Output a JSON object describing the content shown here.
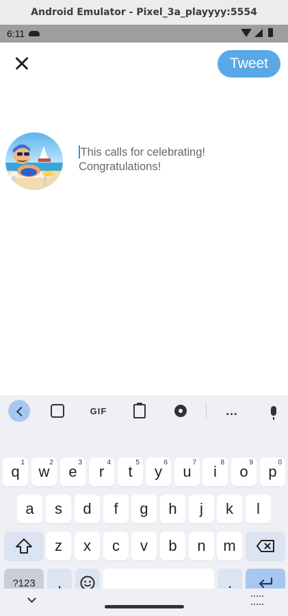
{
  "window": {
    "title": "Android Emulator - Pixel_3a_playyyy:5554"
  },
  "status_bar": {
    "time": "6:11"
  },
  "compose": {
    "tweet_label": "Tweet",
    "text_line1": "This calls for celebrating!",
    "text_line2": "Congratulations!"
  },
  "keyboard": {
    "toolbar": {
      "gif_label": "GIF",
      "more_label": "…"
    },
    "row1": [
      {
        "char": "q",
        "hint": "1"
      },
      {
        "char": "w",
        "hint": "2"
      },
      {
        "char": "e",
        "hint": "3"
      },
      {
        "char": "r",
        "hint": "4"
      },
      {
        "char": "t",
        "hint": "5"
      },
      {
        "char": "y",
        "hint": "6"
      },
      {
        "char": "u",
        "hint": "7"
      },
      {
        "char": "i",
        "hint": "8"
      },
      {
        "char": "o",
        "hint": "9"
      },
      {
        "char": "p",
        "hint": "0"
      }
    ],
    "row2": [
      "a",
      "s",
      "d",
      "f",
      "g",
      "h",
      "j",
      "k",
      "l"
    ],
    "row3": [
      "z",
      "x",
      "c",
      "v",
      "b",
      "n",
      "m"
    ],
    "symbols_label": "?123",
    "comma": ",",
    "period": "."
  },
  "colors": {
    "accent": "#5aa9e6",
    "keyboard_bg": "#eef0f5",
    "key_blue": "#a8c7f0"
  }
}
